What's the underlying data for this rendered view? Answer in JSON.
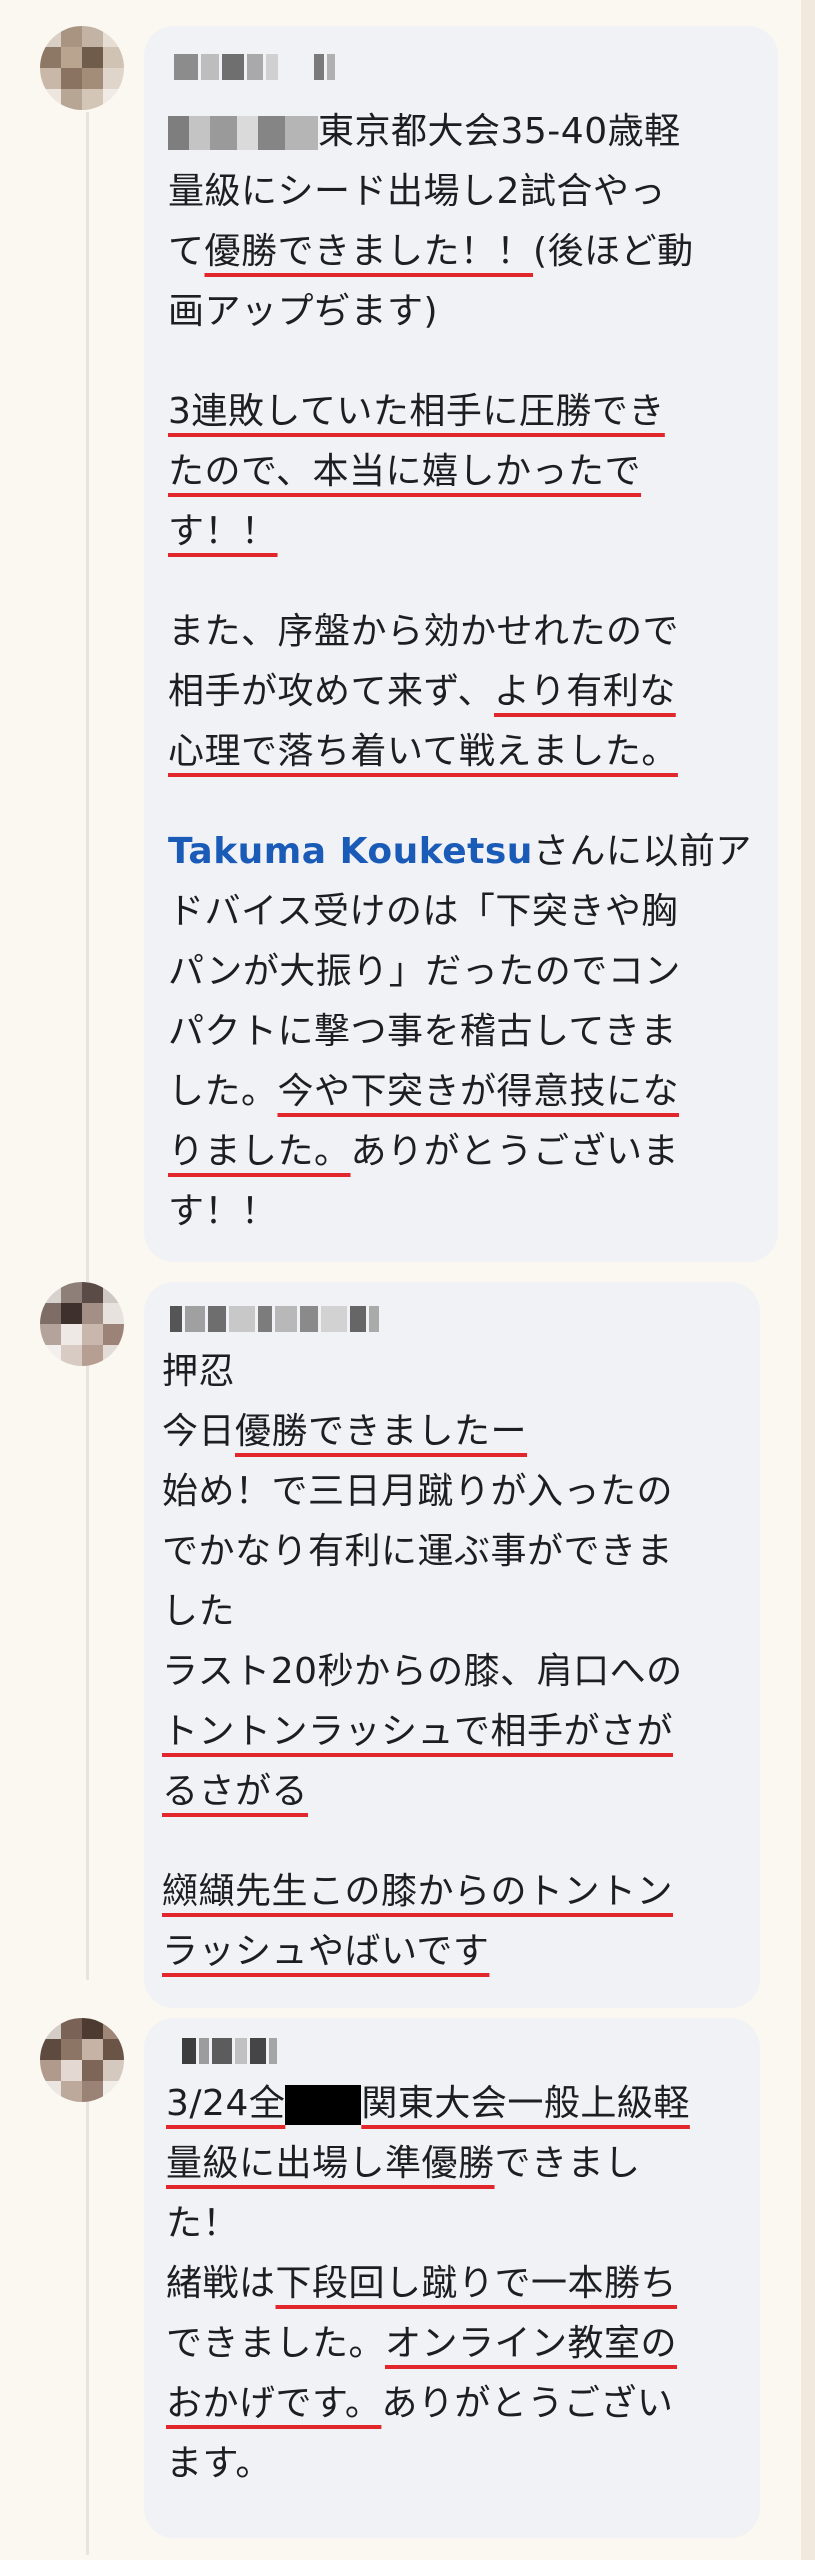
{
  "comments": [
    {
      "author": "",
      "segments_l1": [
        "東京都大会35-40歳軽"
      ],
      "lines": [
        [
          {
            "t": "量級にシード出場し2試合やっ"
          }
        ],
        [
          {
            "t": "て"
          },
          {
            "t": "優勝できました！！",
            "u": true
          },
          {
            "t": "(後ほど動"
          }
        ],
        [
          {
            "t": "画アップぢます)"
          }
        ],
        [],
        [
          {
            "t": "3連敗していた相手に圧勝でき",
            "u": true
          }
        ],
        [
          {
            "t": "たので、本当に嬉しかったで",
            "u": true
          }
        ],
        [
          {
            "t": "す！！",
            "u": true
          }
        ],
        [],
        [
          {
            "t": "また、序盤から効かせれたので"
          }
        ],
        [
          {
            "t": "相手が攻めて来ず、"
          },
          {
            "t": "より有利な",
            "u": true
          }
        ],
        [
          {
            "t": "心理で落ち着いて戦えました。",
            "u": true
          }
        ],
        [],
        [
          {
            "t": "Takuma Kouketsu",
            "m": true
          },
          {
            "t": "さんに以前ア"
          }
        ],
        [
          {
            "t": "ドバイス受けのは「下突きや胸"
          }
        ],
        [
          {
            "t": "パンが大振り」だったのでコン"
          }
        ],
        [
          {
            "t": "パクトに撃つ事を稽古してきま"
          }
        ],
        [
          {
            "t": "した。"
          },
          {
            "t": "今や下突きが得意技にな",
            "u": true
          }
        ],
        [
          {
            "t": "りました。",
            "u": true
          },
          {
            "t": "ありがとうございま"
          }
        ],
        [
          {
            "t": "す！！"
          }
        ]
      ]
    },
    {
      "author": "",
      "lines": [
        [
          {
            "t": "押忍"
          }
        ],
        [
          {
            "t": "今日"
          },
          {
            "t": "優勝できましたー",
            "u": true
          }
        ],
        [
          {
            "t": "始め！で三日月蹴りが入ったの"
          }
        ],
        [
          {
            "t": "でかなり有利に運ぶ事ができま"
          }
        ],
        [
          {
            "t": "した"
          }
        ],
        [
          {
            "t": "ラスト20秒からの膝、肩口への"
          }
        ],
        [
          {
            "t": "トントンラッシュで相手がさが",
            "u": true
          }
        ],
        [
          {
            "t": "るさがる",
            "u": true
          }
        ],
        [],
        [
          {
            "t": "纐纈先生この膝からのトントン",
            "u": true
          }
        ],
        [
          {
            "t": "ラッシュやばいです",
            "u": true
          }
        ]
      ]
    },
    {
      "author": "",
      "l1_a": "3/24全",
      "l1_b": "関東大会一般上級軽",
      "lines": [
        [
          {
            "t": "量級に出場し準優勝",
            "u": true
          },
          {
            "t": "できまし"
          }
        ],
        [
          {
            "t": "た！"
          }
        ],
        [
          {
            "t": "緒戦は"
          },
          {
            "t": "下段回し蹴りで一本勝ち",
            "u": true
          }
        ],
        [
          {
            "t": "できました。"
          },
          {
            "t": "オンライン教室の",
            "u": true
          }
        ],
        [
          {
            "t": "おかげです。",
            "u": true
          },
          {
            "t": "ありがとうござい"
          }
        ],
        [
          {
            "t": "ます。"
          }
        ]
      ]
    }
  ],
  "colors": {
    "bubble": "#f0f2f5",
    "text": "#1c1e21",
    "underline": "#e1262c",
    "mention": "#1a5bb8",
    "background": "#fbf7f1"
  }
}
